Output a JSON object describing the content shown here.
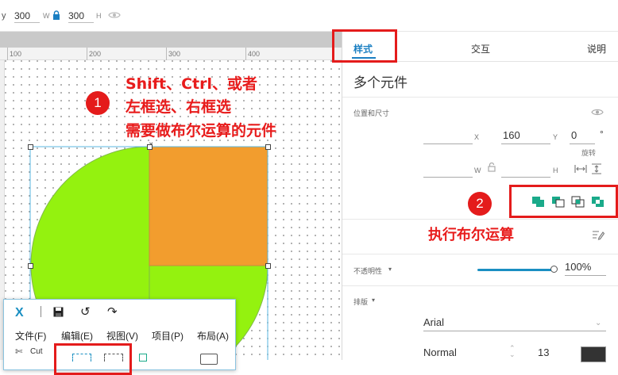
{
  "toolbar": {
    "prefix_label": "y",
    "width_value": "300",
    "width_label": "W",
    "height_value": "300",
    "height_label": "H"
  },
  "ruler": {
    "ticks": [
      "100",
      "200",
      "300",
      "400"
    ]
  },
  "annotations": {
    "step1_num": "1",
    "step1_line1": "Shift、Ctrl、或者",
    "step1_line2": "左框选、右框选",
    "step1_line3": "需要做布尔运算的元件",
    "step2_num": "2",
    "step2_label": "执行布尔运算"
  },
  "panel": {
    "tabs": [
      "样式",
      "交互",
      "说明"
    ],
    "title": "多个元件",
    "position_section": "位置和尺寸",
    "x_label": "X",
    "x_value": "",
    "x2_value": "160",
    "y_label": "Y",
    "y_value": "0",
    "rotation_label": "旋转",
    "degree_symbol": "°",
    "w_label": "W",
    "h_label": "H",
    "opacity_label": "不透明性",
    "opacity_value": "100%",
    "opacity_level": 1.0,
    "typography_label": "排版",
    "font_family": "Arial",
    "font_weight": "Normal",
    "font_size": "13",
    "colors": {
      "accent": "#1a8fc2",
      "bool_icon": "#1aaa8a"
    }
  },
  "floatwin": {
    "logo": "X",
    "menus": [
      "文件(F)",
      "编辑(E)",
      "视图(V)",
      "项目(P)",
      "布局(A)"
    ],
    "cut_label": "Cut"
  },
  "colors": {
    "circle_fill": "#94f20f",
    "square_fill": "#f29d2e",
    "annotation": "#e81c1c"
  }
}
